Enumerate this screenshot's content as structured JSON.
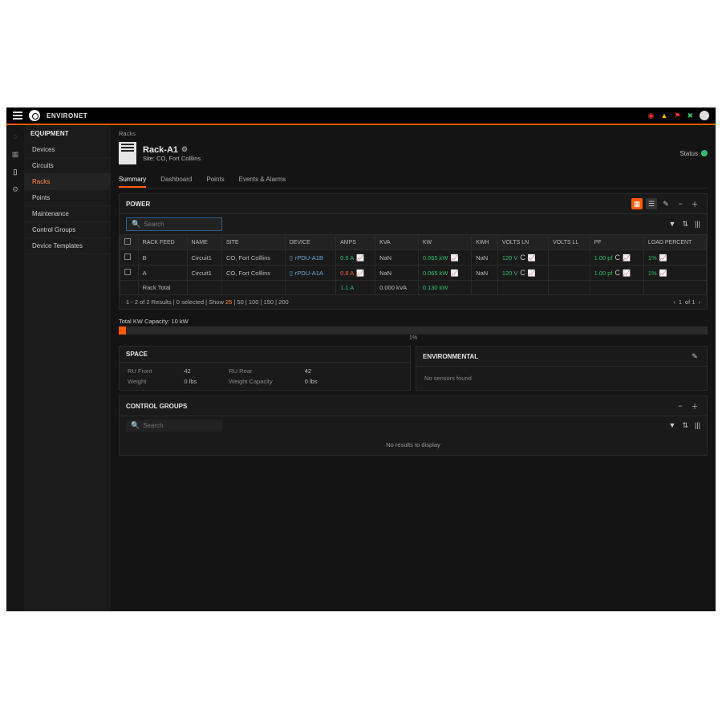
{
  "brand": "ENVIRONET",
  "sidebar": {
    "title": "EQUIPMENT",
    "items": [
      "Devices",
      "Circuits",
      "Racks",
      "Points",
      "Maintenance",
      "Control Groups",
      "Device Templates"
    ],
    "active_index": 2
  },
  "breadcrumb": "Racks",
  "page": {
    "title": "Rack-A1",
    "site_prefix": "Site:",
    "site": "CO, Fort Colllins",
    "status_label": "Status"
  },
  "tabs": [
    "Summary",
    "Dashboard",
    "Points",
    "Events & Alarms"
  ],
  "power": {
    "title": "POWER",
    "search_placeholder": "Search",
    "columns": [
      "RACK FEED",
      "NAME",
      "SITE",
      "DEVICE",
      "AMPS",
      "KVA",
      "KW",
      "KWH",
      "VOLTS LN",
      "VOLTS LL",
      "PF",
      "LOAD PERCENT"
    ],
    "rows": [
      {
        "feed": "B",
        "name": "Circuit1",
        "site": "CO, Fort Colllins",
        "device": "rPDU-A1B",
        "amps": "0.6 A",
        "amps_class": "green",
        "kva": "NaN",
        "kw": "0.065 kW",
        "kwh": "NaN",
        "vln": "120 V",
        "vll": "",
        "pf": "1.00 pf",
        "load": "1%"
      },
      {
        "feed": "A",
        "name": "Circuit1",
        "site": "CO, Fort Colllins",
        "device": "rPDU-A1A",
        "amps": "0.8 A",
        "amps_class": "red",
        "kva": "NaN",
        "kw": "0.065 kW",
        "kwh": "NaN",
        "vln": "120 V",
        "vll": "",
        "pf": "1.00 pf",
        "load": "1%"
      }
    ],
    "total_row": {
      "feed": "Rack Total",
      "amps": "1.1 A",
      "kva": "0.000 kVA",
      "kw": "0.130 kW"
    },
    "pager_left_a": "1 - 2 of 2 Results | 0 selected | Show ",
    "pager_left_b": "25",
    "pager_left_c": " | 50 | 100 | 150 | 200",
    "pager_page": "1",
    "pager_of": "of 1",
    "capacity_label": "Total KW Capacity: 10 kW",
    "capacity_pct": "1%"
  },
  "space": {
    "title": "SPACE",
    "ru_front_k": "RU Front",
    "ru_front_v": "42",
    "ru_rear_k": "RU Rear",
    "ru_rear_v": "42",
    "weight_k": "Weight",
    "weight_v": "0 lbs",
    "wcap_k": "Weight Capacity",
    "wcap_v": "0 lbs"
  },
  "env": {
    "title": "ENVIRONMENTAL",
    "msg": "No sensors found"
  },
  "cg": {
    "title": "CONTROL GROUPS",
    "search_placeholder": "Search",
    "msg": "No results to display"
  }
}
